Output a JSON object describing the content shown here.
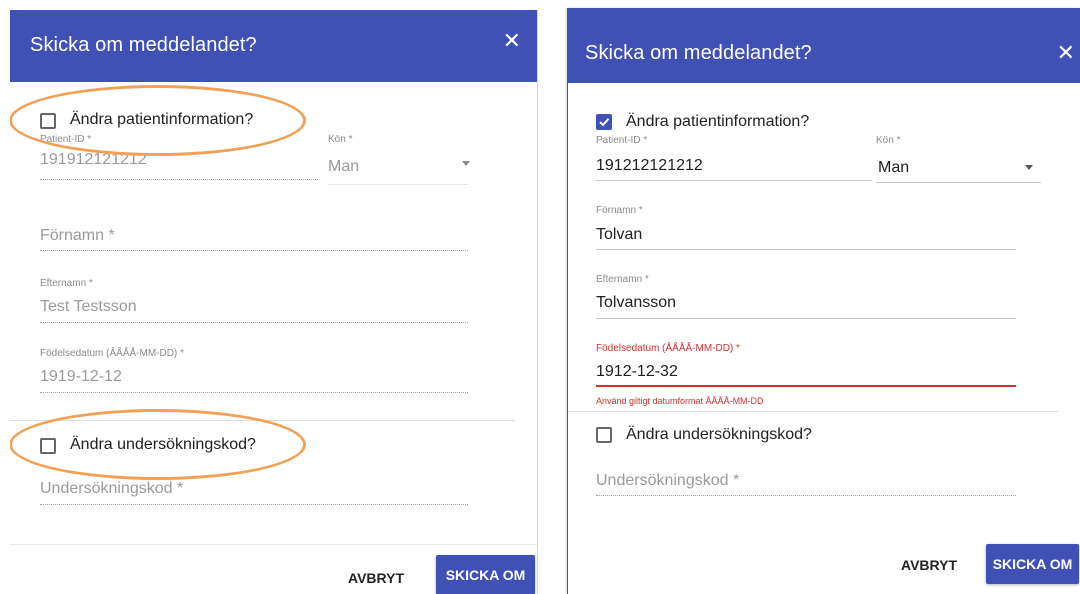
{
  "colors": {
    "header": "#3f51b5",
    "error": "#d32f2f",
    "highlight": "#f0a155"
  },
  "left_dialog": {
    "title": "Skicka om meddelandet?",
    "close_icon": "✕",
    "patient_checkbox": {
      "label": "Ändra patientinformation?",
      "checked": false
    },
    "patient_id": {
      "label": "Patient-ID *",
      "value": "191912121212"
    },
    "gender": {
      "label": "Kön *",
      "value": "Man"
    },
    "first_name": {
      "placeholder": "Förnamn *"
    },
    "last_name": {
      "label": "Efternamn *",
      "value": "Test Testsson"
    },
    "birth_date": {
      "label": "Födelsedatum (ÅÅÅÅ-MM-DD) *",
      "value": "1919-12-12"
    },
    "exam_checkbox": {
      "label": "Ändra undersökningskod?",
      "checked": false
    },
    "exam_code": {
      "placeholder": "Undersökningskod *"
    },
    "cancel_label": "AVBRYT",
    "resend_label": "SKICKA OM"
  },
  "right_dialog": {
    "title": "Skicka om meddelandet?",
    "close_icon": "✕",
    "patient_checkbox": {
      "label": "Ändra patientinformation?",
      "checked": true
    },
    "patient_id": {
      "label": "Patient-ID *",
      "value": "191212121212"
    },
    "gender": {
      "label": "Kön *",
      "value": "Man"
    },
    "first_name": {
      "label": "Förnamn *",
      "value": "Tolvan"
    },
    "last_name": {
      "label": "Efternamn *",
      "value": "Tolvansson"
    },
    "birth_date": {
      "label": "Födelsedatum (ÅÅÅÅ-MM-DD) *",
      "value": "1912-12-32",
      "error": "Använd giltigt datumformat ÅÅÅÅ-MM-DD"
    },
    "exam_checkbox": {
      "label": "Ändra undersökningskod?",
      "checked": false
    },
    "exam_code": {
      "placeholder": "Undersökningskod *"
    },
    "cancel_label": "AVBRYT",
    "resend_label": "SKICKA OM"
  }
}
